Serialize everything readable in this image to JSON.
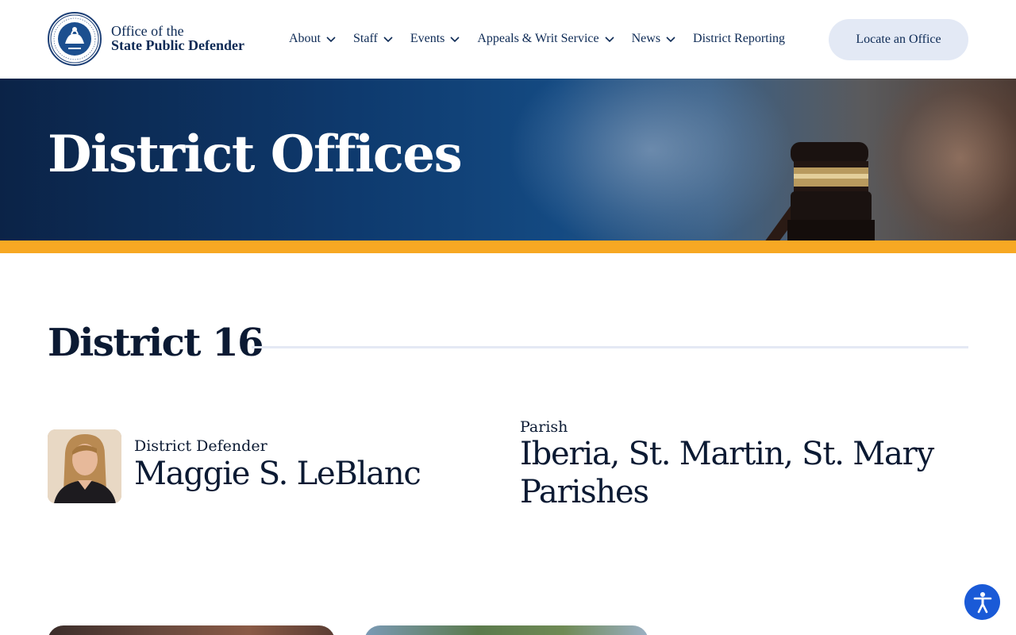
{
  "header": {
    "brand_line1": "Office of the",
    "brand_line2": "State Public Defender",
    "nav": [
      {
        "label": "About",
        "has_menu": true
      },
      {
        "label": "Staff",
        "has_menu": true
      },
      {
        "label": "Events",
        "has_menu": true
      },
      {
        "label": "Appeals & Writ Service",
        "has_menu": true
      },
      {
        "label": "News",
        "has_menu": true
      },
      {
        "label": "District Reporting",
        "has_menu": false
      }
    ],
    "cta_label": "Locate an Office"
  },
  "hero": {
    "title": "District Offices"
  },
  "district": {
    "title": "District 16",
    "defender_label": "District Defender",
    "defender_name": "Maggie S. LeBlanc",
    "parish_label": "Parish",
    "parish_name": "Iberia, St. Martin, St. Mary Parishes"
  },
  "colors": {
    "navy": "#0d2a55",
    "accent_stripe": "#f7a823",
    "cta_bg": "#e3e9f5",
    "a11y_blue": "#1a5ad7"
  },
  "icons": {
    "logo": "louisiana-state-seal-icon",
    "nav_chevron": "chevron-down-icon",
    "accessibility": "accessibility-icon"
  }
}
